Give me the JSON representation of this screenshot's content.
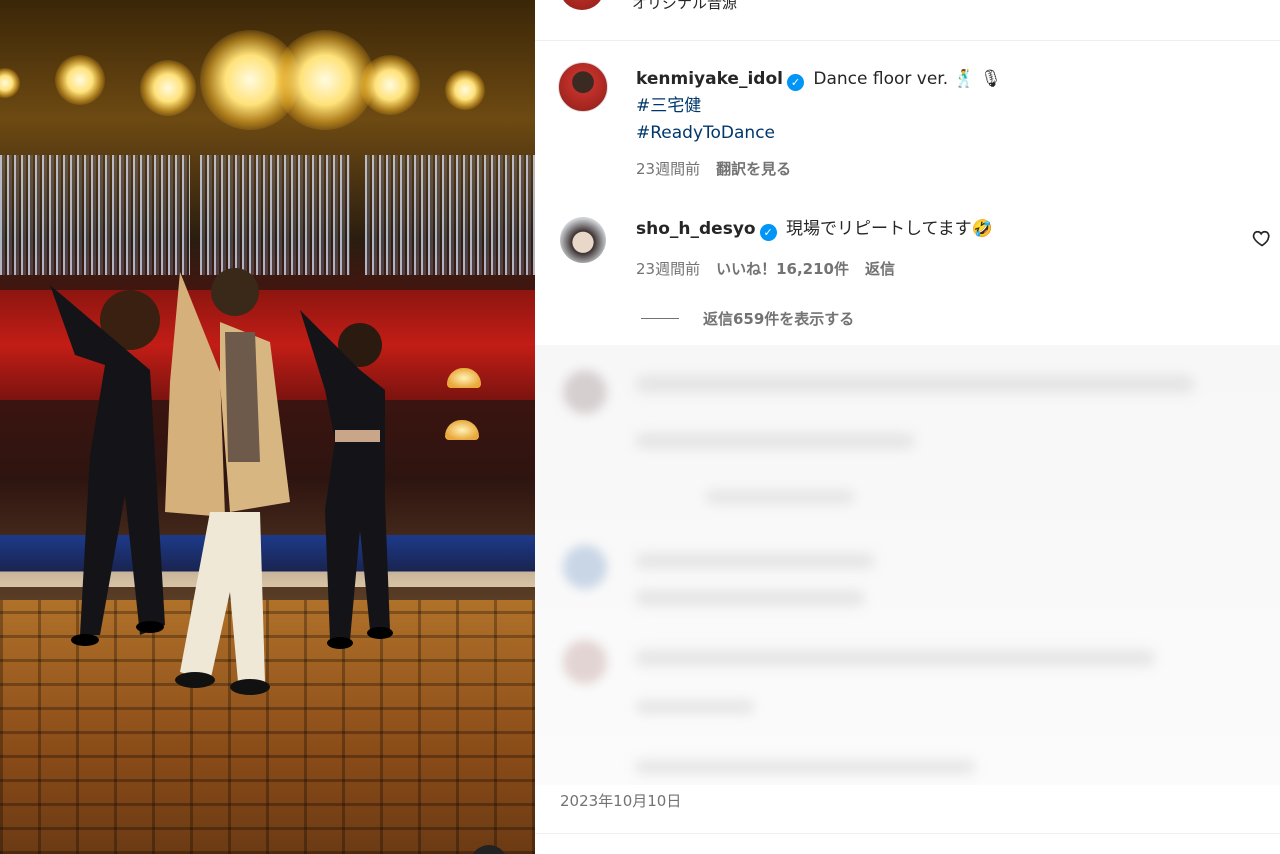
{
  "post": {
    "audio_label": "オリジナル音源",
    "author": {
      "username": "kenmiyake_idol",
      "verified": true,
      "caption": "Dance floor ver. 🕺 🎙",
      "hashtags": [
        "#三宅健",
        "#ReadyToDance"
      ],
      "time_ago": "23週間前",
      "translate_label": "翻訳を見る"
    },
    "comments": [
      {
        "username": "sho_h_desyo",
        "verified": true,
        "text": "現場でリピートしてます🤣",
        "time_ago": "23週間前",
        "likes_label": "いいね！16,210件",
        "reply_label": "返信",
        "view_replies_label": "返信659件を表示する"
      }
    ],
    "date": "2023年10月10日"
  },
  "colors": {
    "link": "#00376b",
    "verified": "#0095f6",
    "meta": "#737373"
  },
  "icons": {
    "verified": "verified-badge-icon",
    "heart": "heart-icon"
  }
}
